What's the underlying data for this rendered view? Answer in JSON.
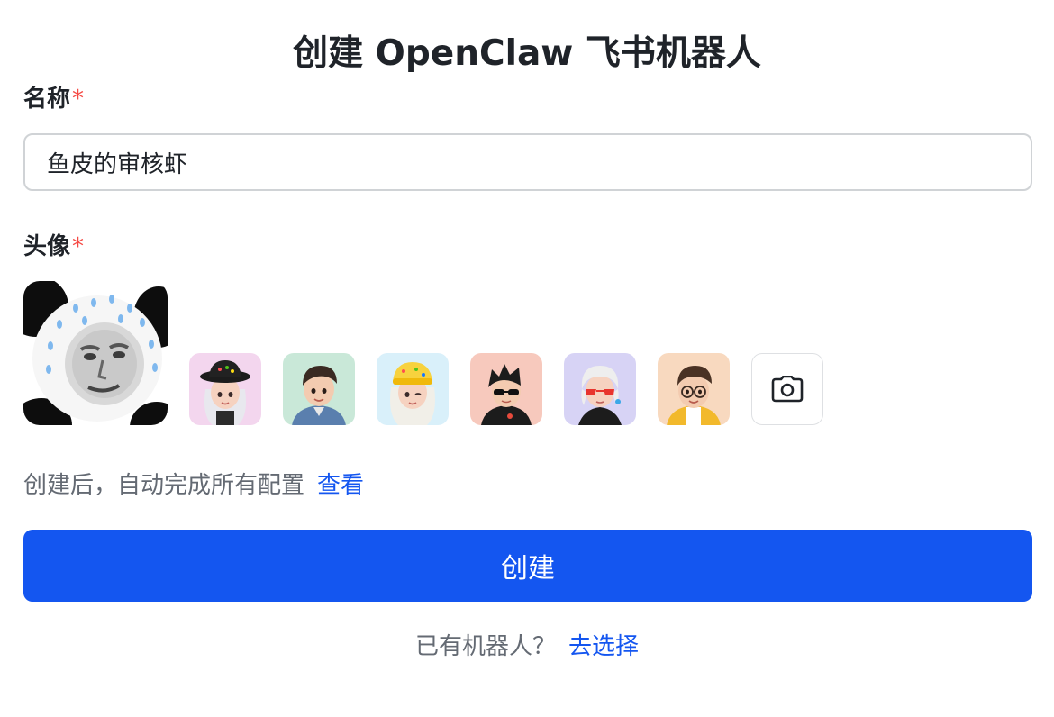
{
  "title": "创建 OpenClaw 飞书机器人",
  "name_field": {
    "label": "名称",
    "required_mark": "*",
    "value": "鱼皮的审核虾"
  },
  "avatar_field": {
    "label": "头像",
    "required_mark": "*",
    "selected": "panda-meme-avatar",
    "options": [
      {
        "name": "girl-black-hat-avatar",
        "bg": "#f3d6ee"
      },
      {
        "name": "boy-denim-jacket-avatar",
        "bg": "#c9e8d8"
      },
      {
        "name": "girl-yellow-hat-avatar",
        "bg": "#d9f0fa"
      },
      {
        "name": "boy-sunglasses-avatar",
        "bg": "#f7c9bd"
      },
      {
        "name": "girl-red-glasses-avatar",
        "bg": "#d7d3f5"
      },
      {
        "name": "boy-glasses-yellow-jacket-avatar",
        "bg": "#f8d9bf"
      }
    ]
  },
  "hint": {
    "text": "创建后，自动完成所有配置",
    "link": "查看"
  },
  "create_button": "创建",
  "footer": {
    "text": "已有机器人？",
    "link": "去选择"
  },
  "colors": {
    "primary": "#1456f0",
    "required": "#f54a45",
    "muted_text": "#646a73"
  }
}
